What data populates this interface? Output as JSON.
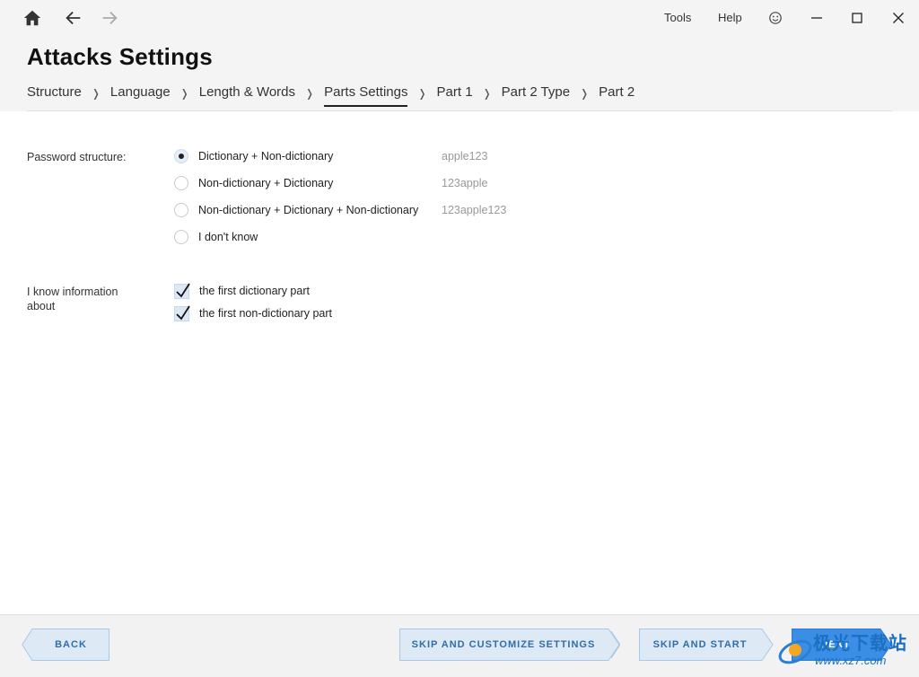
{
  "topbar": {
    "menu": [
      "Tools",
      "Help"
    ]
  },
  "page": {
    "title": "Attacks Settings"
  },
  "breadcrumb": [
    {
      "label": "Structure",
      "active": false
    },
    {
      "label": "Language",
      "active": false
    },
    {
      "label": "Length & Words",
      "active": false
    },
    {
      "label": "Parts Settings",
      "active": true
    },
    {
      "label": "Part 1",
      "active": false
    },
    {
      "label": "Part 2 Type",
      "active": false
    },
    {
      "label": "Part 2",
      "active": false
    }
  ],
  "breadcrumb_separator": "❭",
  "password_structure": {
    "label": "Password structure:",
    "options": [
      {
        "label": "Dictionary + Non-dictionary",
        "example": "apple123",
        "selected": true
      },
      {
        "label": "Non-dictionary + Dictionary",
        "example": "123apple",
        "selected": false
      },
      {
        "label": "Non-dictionary + Dictionary + Non-dictionary",
        "example": "123apple123",
        "selected": false
      },
      {
        "label": "I don't know",
        "example": "",
        "selected": false
      }
    ]
  },
  "known_info": {
    "label": "I know information about",
    "options": [
      {
        "label": "the first dictionary part",
        "checked": true
      },
      {
        "label": "the first non-dictionary part",
        "checked": true
      }
    ]
  },
  "footer": {
    "back_label": "BACK",
    "skip_customize_label": "SKIP AND CUSTOMIZE SETTINGS",
    "skip_start_label": "SKIP AND START",
    "next_label": "NEXT"
  },
  "watermark": {
    "text": "极光下载站",
    "url": "www.xz7.com"
  },
  "colors": {
    "button_border": "#a8c8e8",
    "button_fill": "#dde9f5",
    "button_text": "#2f6ea8",
    "primary_fill": "#3a8ee6"
  }
}
